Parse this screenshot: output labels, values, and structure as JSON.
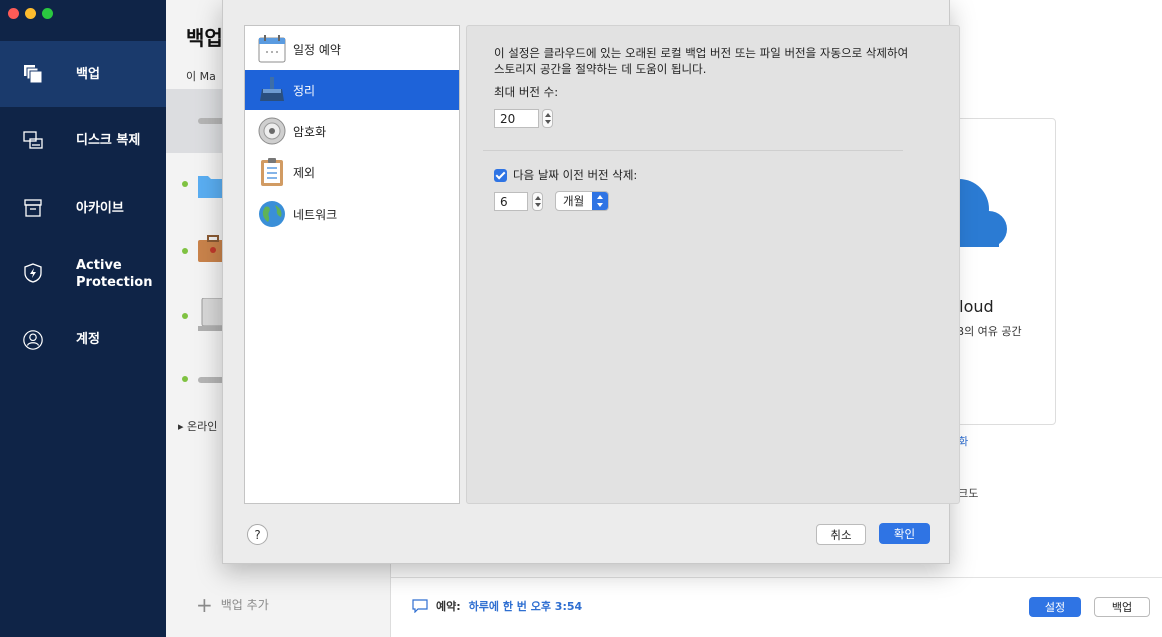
{
  "sidebar": {
    "items": [
      {
        "label": "백업",
        "icon": "backup-icon",
        "active": true
      },
      {
        "label": "디스크 복제",
        "icon": "disk-clone-icon"
      },
      {
        "label": "아카이브",
        "icon": "archive-icon"
      },
      {
        "label": "Active Protection",
        "icon": "shield-bolt-icon"
      },
      {
        "label": "계정",
        "icon": "account-icon"
      }
    ]
  },
  "backup_list": {
    "title": "백업",
    "subtitle": "이 Ma",
    "online_label": "▸ 온라인",
    "add_label": "백업 추가"
  },
  "destination": {
    "title": "Cloud",
    "free_space": "GB의 여유 공간",
    "encryption_link": "호화",
    "network_text": "워크도"
  },
  "footer": {
    "schedule_label": "예약:",
    "schedule_value": "하루에 한 번 오후 3:54",
    "settings_button": "설정",
    "backup_button": "백업"
  },
  "dialog": {
    "categories": [
      {
        "label": "일정 예약",
        "icon": "calendar-icon"
      },
      {
        "label": "정리",
        "icon": "broom-icon",
        "selected": true
      },
      {
        "label": "암호화",
        "icon": "lock-dial-icon"
      },
      {
        "label": "제외",
        "icon": "clipboard-list-icon"
      },
      {
        "label": "네트워크",
        "icon": "globe-icon"
      }
    ],
    "cleanup": {
      "description": "이 설정은 클라우드에 있는 오래된 로컬 백업 버전 또는 파일 버전을 자동으로 삭제하여 스토리지 공간을 절약하는 데 도움이 됩니다.",
      "max_versions_label": "최대 버전 수:",
      "max_versions_value": "20",
      "delete_older_label": "다음 날짜 이전 버전 삭제:",
      "delete_older_checked": true,
      "delete_older_value": "6",
      "delete_older_unit": "개월"
    },
    "help_label": "?",
    "cancel_button": "취소",
    "ok_button": "확인"
  },
  "colors": {
    "sidebar_bg": "#0f2447",
    "accent": "#2f74e4",
    "selected_category": "#1e63d9",
    "status_dot": "#7fc241"
  }
}
